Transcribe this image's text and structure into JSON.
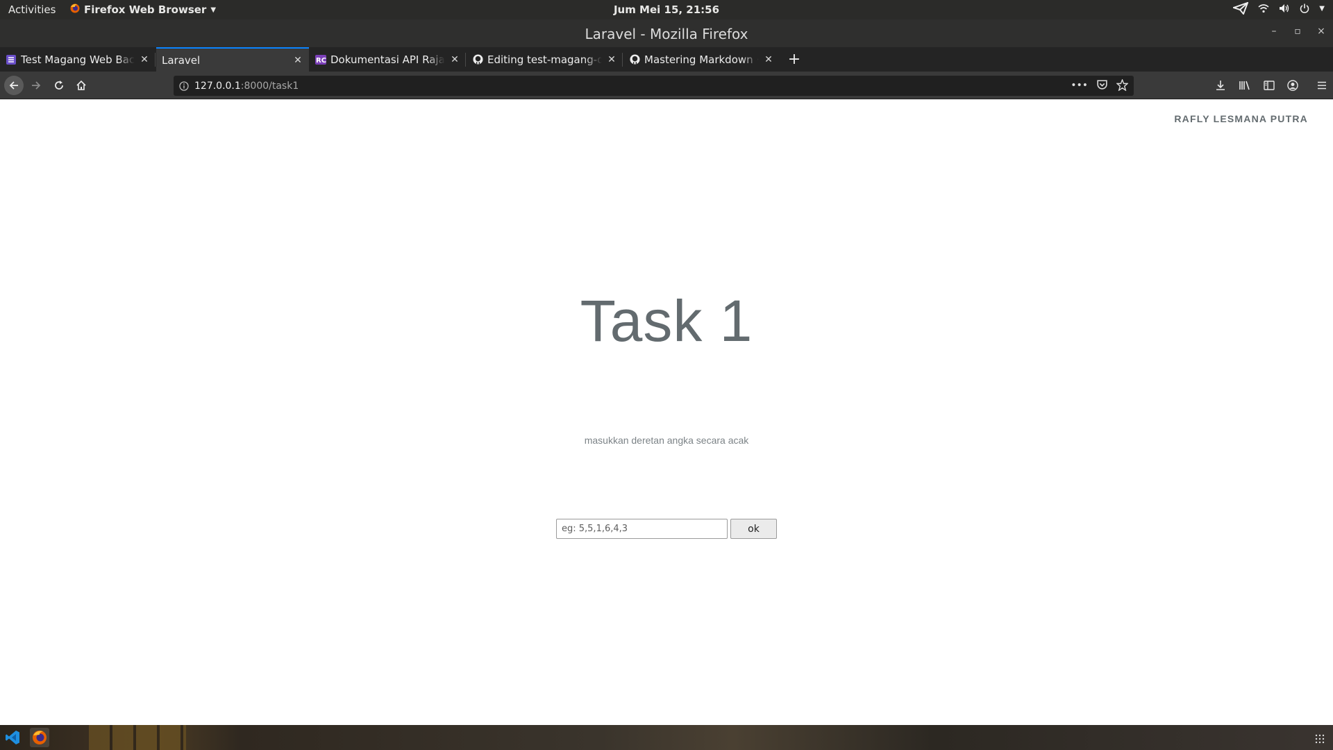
{
  "system": {
    "activities": "Activities",
    "app_menu": "Firefox Web Browser",
    "clock": "Jum Mei 15, 21:56"
  },
  "window": {
    "title": "Laravel - Mozilla Firefox"
  },
  "tabs": [
    {
      "label": "Test Magang Web Backend",
      "icon": "list-icon",
      "active": false
    },
    {
      "label": "Laravel",
      "icon": "",
      "active": true
    },
    {
      "label": "Dokumentasi API RajaOngkir",
      "icon": "rc-icon",
      "active": false
    },
    {
      "label": "Editing test-magang-docs",
      "icon": "github-icon",
      "active": false
    },
    {
      "label": "Mastering Markdown · GitHub",
      "icon": "github-icon",
      "active": false
    }
  ],
  "address": {
    "host": "127.0.0.1",
    "path": ":8000/task1"
  },
  "page": {
    "author": "RAFLY LESMANA PUTRA",
    "heading": "Task 1",
    "subtitle": "masukkan deretan angka secara acak",
    "input_placeholder": "eg: 5,5,1,6,4,3",
    "input_value": "",
    "submit_label": "ok"
  },
  "colors": {
    "accent": "#0a84ff",
    "heading": "#636b6f"
  }
}
